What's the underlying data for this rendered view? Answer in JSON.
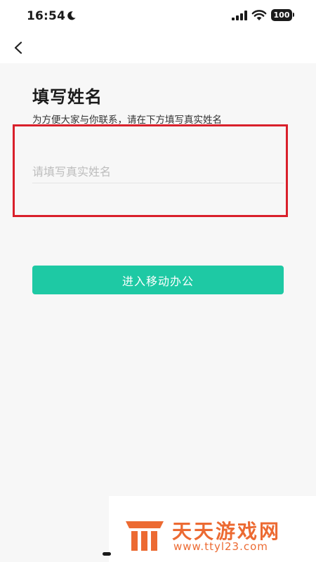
{
  "status_bar": {
    "time": "16:54",
    "battery": "100",
    "icons": [
      "moon-icon",
      "signal-icon",
      "wifi-icon",
      "battery-icon"
    ]
  },
  "nav": {
    "back_icon": "chevron-left-icon"
  },
  "form": {
    "title": "填写姓名",
    "subtitle": "为方便大家与你联系，请在下方填写真实姓名",
    "name_value": "",
    "name_placeholder": "请填写真实姓名",
    "submit_label": "进入移动办公"
  },
  "colors": {
    "accent": "#1ec9a4",
    "highlight": "#d9202b",
    "watermark": "#ec6a32"
  },
  "watermark": {
    "brand": "天天游戏网",
    "url": "www.ttyl23.com"
  }
}
